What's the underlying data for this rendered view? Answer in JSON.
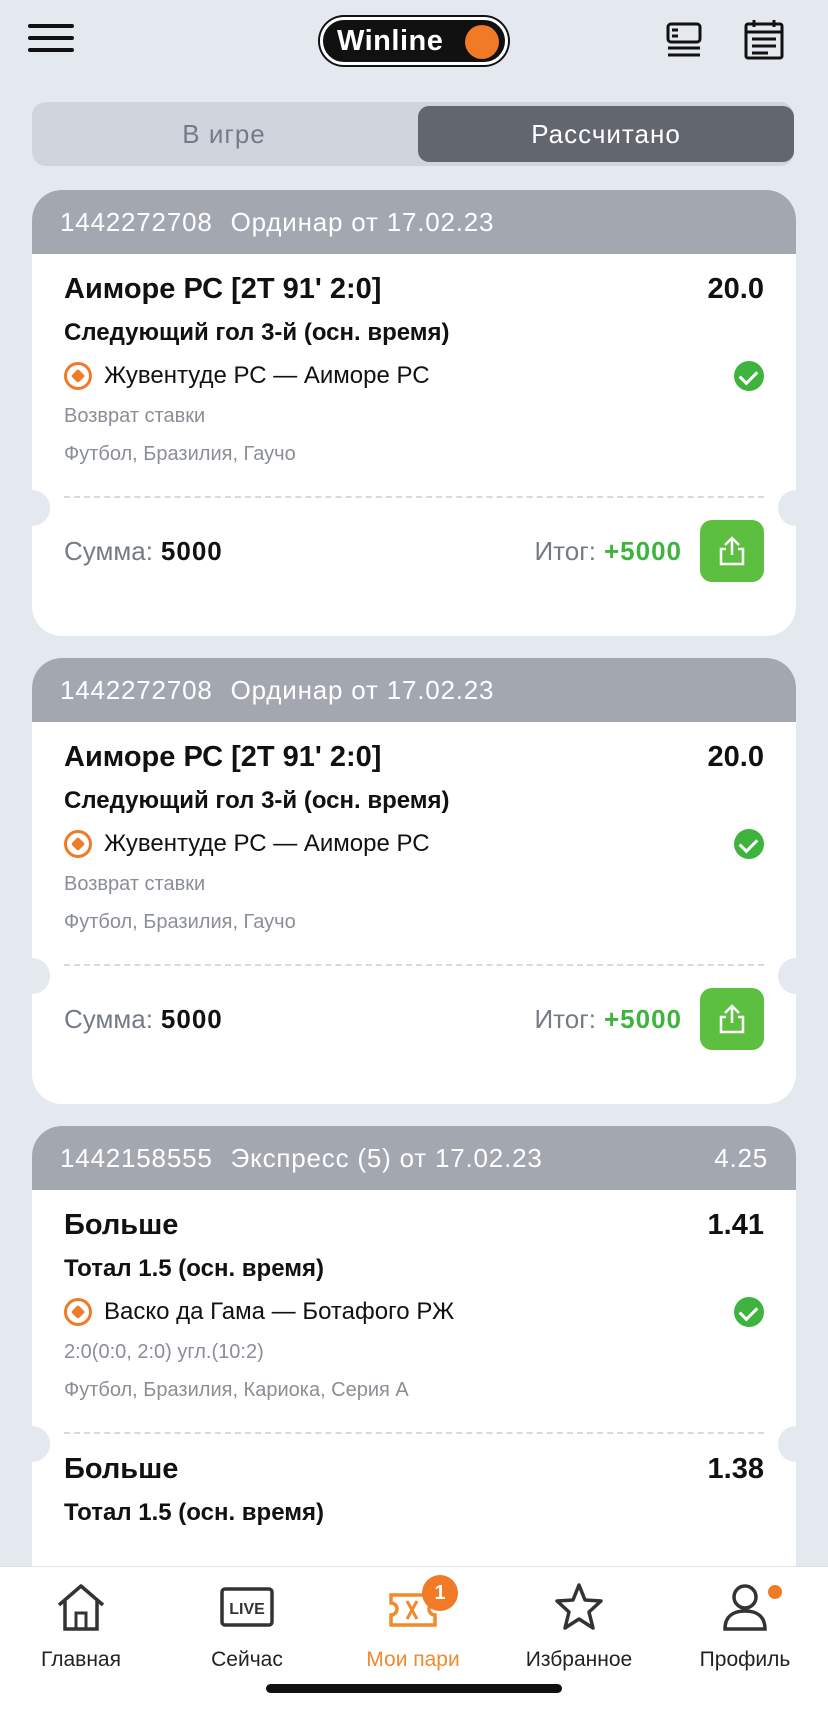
{
  "header": {
    "logo_text": "Winline"
  },
  "tabs_segment": {
    "in_game": "В игре",
    "settled": "Рассчитано"
  },
  "cards": [
    {
      "id": "1442272708",
      "type": "Ординар от 17.02.23",
      "total_odds": "",
      "selections": [
        {
          "title": "Аиморе РС [2Т 91' 2:0]",
          "odds": "20.0",
          "market": "Следующий гол 3-й (осн. время)",
          "event": "Жувентуде РС — Аиморе РС",
          "note": "Возврат ставки",
          "sport": "Футбол, Бразилия, Гаучо"
        }
      ],
      "sum_label": "Сумма:",
      "sum_value": "5000",
      "result_label": "Итог:",
      "result_value": "+5000"
    },
    {
      "id": "1442272708",
      "type": "Ординар от 17.02.23",
      "total_odds": "",
      "selections": [
        {
          "title": "Аиморе РС [2Т 91' 2:0]",
          "odds": "20.0",
          "market": "Следующий гол 3-й (осн. время)",
          "event": "Жувентуде РС — Аиморе РС",
          "note": "Возврат ставки",
          "sport": "Футбол, Бразилия, Гаучо"
        }
      ],
      "sum_label": "Сумма:",
      "sum_value": "5000",
      "result_label": "Итог:",
      "result_value": "+5000"
    },
    {
      "id": "1442158555",
      "type": "Экспресс (5) от 17.02.23",
      "total_odds": "4.25",
      "selections": [
        {
          "title": "Больше",
          "odds": "1.41",
          "market": "Тотал 1.5 (осн. время)",
          "event": "Васко да Гама — Ботафого РЖ",
          "note": "2:0(0:0, 2:0) угл.(10:2)",
          "sport": "Футбол, Бразилия, Кариока, Серия А"
        },
        {
          "title": "Больше",
          "odds": "1.38",
          "market": "Тотал 1.5 (осн. время)"
        }
      ]
    }
  ],
  "tabbar": [
    {
      "label": "Главная",
      "icon": "home-icon"
    },
    {
      "label": "Сейчас",
      "icon": "live-icon",
      "icon_text": "LIVE"
    },
    {
      "label": "Мои пари",
      "icon": "ticket-icon",
      "badge": "1",
      "active": true
    },
    {
      "label": "Избранное",
      "icon": "star-icon"
    },
    {
      "label": "Профиль",
      "icon": "profile-icon"
    }
  ],
  "colors": {
    "accent": "#f07a26",
    "win": "#3eb33e",
    "card_head": "#a3a8b0",
    "active_tab": "#f08a2a"
  }
}
